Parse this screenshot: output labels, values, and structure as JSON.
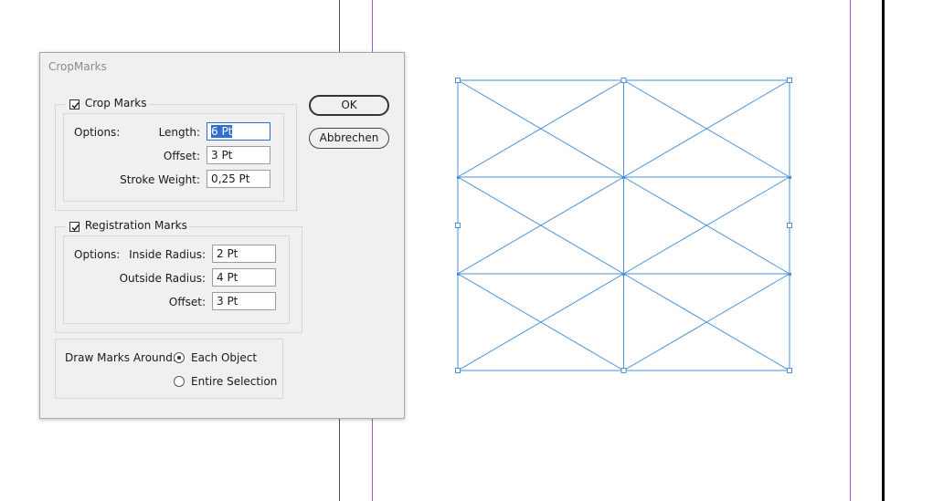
{
  "dialog": {
    "title": "CropMarks",
    "ok_label": "OK",
    "cancel_label": "Abbrechen"
  },
  "crop_marks": {
    "label": "Crop Marks",
    "checked": true,
    "options_label": "Options:",
    "length_label": "Length:",
    "length_value": "6 Pt",
    "offset_label": "Offset:",
    "offset_value": "3 Pt",
    "stroke_label": "Stroke Weight:",
    "stroke_value": "0,25 Pt"
  },
  "registration_marks": {
    "label": "Registration Marks",
    "checked": true,
    "options_label": "Options:",
    "inside_label": "Inside Radius:",
    "inside_value": "2 Pt",
    "outside_label": "Outside Radius:",
    "outside_value": "4 Pt",
    "offset_label": "Offset:",
    "offset_value": "3 Pt"
  },
  "draw_marks": {
    "label": "Draw Marks Around:",
    "options": [
      {
        "label": "Each Object",
        "selected": true
      },
      {
        "label": "Entire Selection",
        "selected": false
      }
    ]
  },
  "colors": {
    "selection_blue": "#4a90d9",
    "margin_guide": "#a64fd6",
    "focus_blue": "#2f6fd0"
  }
}
